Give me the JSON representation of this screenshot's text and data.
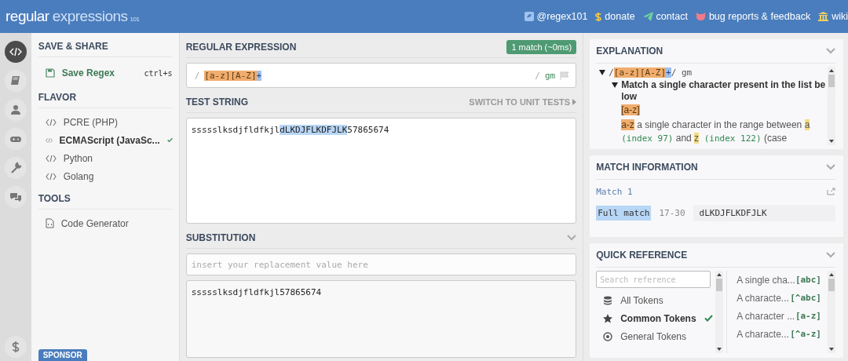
{
  "header": {
    "logo_main": "regular",
    "logo_rest": "expressions",
    "logo_version": "101",
    "links": [
      {
        "label": "@regex101"
      },
      {
        "label": "donate"
      },
      {
        "label": "contact"
      },
      {
        "label": "bug reports & feedback"
      },
      {
        "label": "wiki"
      }
    ]
  },
  "rail": [
    {
      "selected": true
    },
    {
      "selected": false
    },
    {
      "selected": false
    },
    {
      "selected": false
    },
    {
      "selected": false
    },
    {
      "selected": false
    },
    {
      "selected": false
    }
  ],
  "sidebar": {
    "save_title": "SAVE & SHARE",
    "save_label": "Save Regex",
    "save_shortcut": "ctrl+s",
    "flavor_title": "FLAVOR",
    "flavors": [
      {
        "label": "PCRE (PHP)",
        "selected": false
      },
      {
        "label": "ECMAScript (JavaSc...",
        "selected": true
      },
      {
        "label": "Python",
        "selected": false
      },
      {
        "label": "Golang",
        "selected": false
      }
    ],
    "tools_title": "TOOLS",
    "tools": [
      {
        "label": "Code Generator"
      }
    ],
    "sponsor": "SPONSOR"
  },
  "regex": {
    "title": "REGULAR EXPRESSION",
    "match_badge": "1 match (~0ms)",
    "open_delim": "/",
    "tokens": [
      {
        "text": "[a-z]",
        "kind": "class"
      },
      {
        "text": "[A-Z]",
        "kind": "class"
      },
      {
        "text": "+",
        "kind": "quantifier"
      }
    ],
    "close_delim": "/",
    "flags": "gm"
  },
  "test": {
    "title": "TEST STRING",
    "switch_label": "SWITCH TO UNIT TESTS",
    "parts": [
      {
        "text": "ssssslksdjfldfkjl",
        "match": false
      },
      {
        "text": "dLKDJFLKDFJLK",
        "match": true
      },
      {
        "text": "57865674",
        "match": false
      }
    ]
  },
  "substitution": {
    "title": "SUBSTITUTION",
    "placeholder": "insert your replacement value here",
    "result": "ssssslksdjfldfkjl57865674"
  },
  "explanation": {
    "title": "EXPLANATION",
    "root": [
      {
        "text": "/",
        "kind": "plain"
      },
      {
        "text": "[a-z]",
        "kind": "class"
      },
      {
        "text": "[A-Z]",
        "kind": "class"
      },
      {
        "text": "+",
        "kind": "quantifier"
      },
      {
        "text": "/ gm",
        "kind": "plain"
      }
    ],
    "children": [
      {
        "heading": "Match a single character present in the list below",
        "lines": [
          [
            {
              "text": "[a-z]",
              "kind": "class"
            }
          ],
          [
            {
              "text": "a-z",
              "kind": "class"
            },
            {
              "text": " a single character in the range between ",
              "kind": "plain"
            },
            {
              "text": "a",
              "kind": "literal"
            },
            {
              "text": " (index 97)",
              "kind": "index"
            },
            {
              "text": " and ",
              "kind": "plain"
            },
            {
              "text": "z",
              "kind": "literal"
            },
            {
              "text": " (index 122)",
              "kind": "index"
            },
            {
              "text": " (case",
              "kind": "plain"
            }
          ]
        ]
      }
    ]
  },
  "match_info": {
    "title": "MATCH INFORMATION",
    "match_title": "Match 1",
    "rows": [
      {
        "label": "Full match",
        "range": "17-30",
        "value": "dLKDJFLKDFJLK"
      }
    ]
  },
  "quick_reference": {
    "title": "QUICK REFERENCE",
    "search_placeholder": "Search reference",
    "categories": [
      {
        "label": "All Tokens",
        "selected": false
      },
      {
        "label": "Common Tokens",
        "selected": true
      },
      {
        "label": "General Tokens",
        "selected": false
      }
    ],
    "tokens": [
      {
        "description": "A single cha...",
        "token": "[abc]"
      },
      {
        "description": "A characte...",
        "token": "[^abc]"
      },
      {
        "description": "A character ...",
        "token": "[a-z]"
      },
      {
        "description": "A characte...",
        "token": "[^a-z]"
      }
    ]
  }
}
